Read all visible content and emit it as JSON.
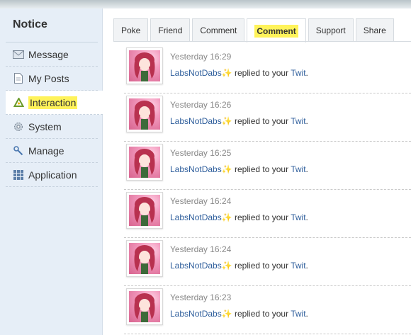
{
  "sidebar": {
    "title": "Notice",
    "items": [
      {
        "label": "Message",
        "icon": "envelope-icon"
      },
      {
        "label": "My Posts",
        "icon": "document-icon"
      },
      {
        "label": "Interaction",
        "icon": "recycle-icon",
        "active": true
      },
      {
        "label": "System",
        "icon": "gear-icon"
      },
      {
        "label": "Manage",
        "icon": "wrench-icon"
      },
      {
        "label": "Application",
        "icon": "grid-icon"
      }
    ]
  },
  "tabs": [
    {
      "label": "Poke"
    },
    {
      "label": "Friend"
    },
    {
      "label": "Comment"
    },
    {
      "label": "Comment",
      "active": true
    },
    {
      "label": "Support"
    },
    {
      "label": "Share"
    }
  ],
  "notifications": [
    {
      "time": "Yesterday 16:29",
      "user": "LabsNotDabs",
      "text": "replied to your",
      "link": "Twit",
      "end": "."
    },
    {
      "time": "Yesterday 16:26",
      "user": "LabsNotDabs",
      "text": "replied to your",
      "link": "Twit",
      "end": "."
    },
    {
      "time": "Yesterday 16:25",
      "user": "LabsNotDabs",
      "text": "replied to your",
      "link": "Twit",
      "end": "."
    },
    {
      "time": "Yesterday 16:24",
      "user": "LabsNotDabs",
      "text": "replied to your",
      "link": "Twit",
      "end": "."
    },
    {
      "time": "Yesterday 16:24",
      "user": "LabsNotDabs",
      "text": "replied to your",
      "link": "Twit",
      "end": "."
    },
    {
      "time": "Yesterday 16:23",
      "user": "LabsNotDabs",
      "text": "replied to your",
      "link": "Twit",
      "end": "."
    }
  ],
  "colors": {
    "highlight": "#fff35a",
    "link": "#2d5d9b",
    "sidebar_bg": "#e6eef7"
  }
}
